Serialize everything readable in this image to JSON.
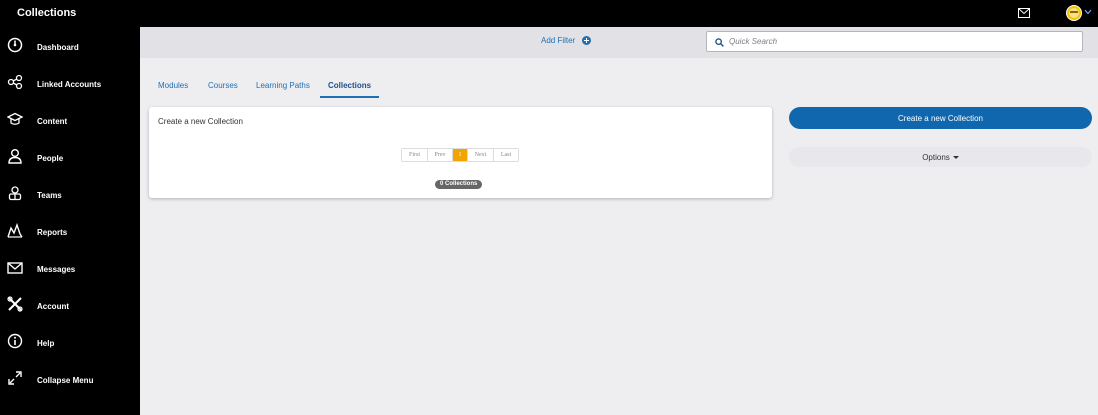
{
  "header": {
    "title": "Collections",
    "icons": [
      "mail-icon",
      "avatar",
      "chevron-down-icon"
    ]
  },
  "sidebar": {
    "items": [
      {
        "label": "Dashboard",
        "icon": "dashboard-icon"
      },
      {
        "label": "Linked Accounts",
        "icon": "linked-accounts-icon"
      },
      {
        "label": "Content",
        "icon": "graduation-cap-icon"
      },
      {
        "label": "People",
        "icon": "person-icon"
      },
      {
        "label": "Teams",
        "icon": "teams-icon"
      },
      {
        "label": "Reports",
        "icon": "reports-icon"
      },
      {
        "label": "Messages",
        "icon": "envelope-icon"
      },
      {
        "label": "Account",
        "icon": "tools-icon"
      },
      {
        "label": "Help",
        "icon": "info-icon"
      },
      {
        "label": "Collapse Menu",
        "icon": "collapse-icon"
      }
    ]
  },
  "filterbar": {
    "add_filter_label": "Add Filter",
    "search_placeholder": "Quick Search"
  },
  "tabs": [
    {
      "label": "Modules",
      "active": false
    },
    {
      "label": "Courses",
      "active": false
    },
    {
      "label": "Learning Paths",
      "active": false
    },
    {
      "label": "Collections",
      "active": true
    }
  ],
  "card": {
    "create_link": "Create a new Collection",
    "pagination": {
      "first": "First",
      "prev": "Prev",
      "current": "1",
      "next": "Next",
      "last": "Last"
    },
    "count_badge": "0 Collections"
  },
  "actions": {
    "create_label": "Create a new Collection",
    "options_label": "Options"
  },
  "colors": {
    "accent": "#1167ad",
    "link": "#1f6fb2",
    "page_current": "#f0a500",
    "sidebar_bg": "#000000",
    "content_bg": "#eeeef1"
  }
}
